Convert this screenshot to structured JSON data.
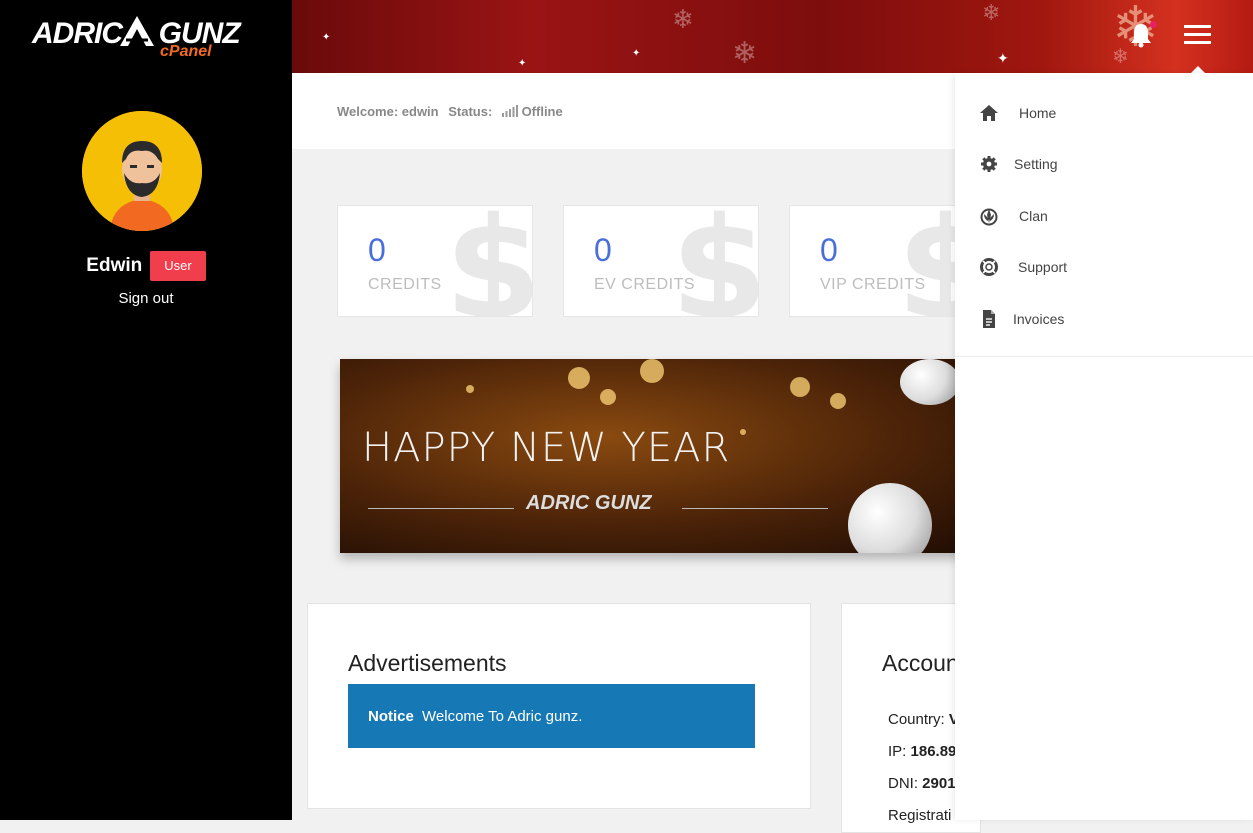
{
  "brand": {
    "logo_text": "ADRIC GUNZ",
    "logo_sub": "cPanel"
  },
  "user": {
    "name": "Edwin",
    "role_badge": "User",
    "sign_out": "Sign out"
  },
  "welcome": {
    "welcome_label": "Welcome: edwin",
    "status_label": "Status:",
    "status_value": "Offline"
  },
  "stats": [
    {
      "value": "0",
      "label": "CREDITS"
    },
    {
      "value": "0",
      "label": "EV CREDITS"
    },
    {
      "value": "0",
      "label": "VIP CREDITS"
    }
  ],
  "banner": {
    "title": "HAPPY NEW YEAR",
    "logo": "ADRIC GUNZ"
  },
  "ads": {
    "title": "Advertisements",
    "notice_label": "Notice",
    "notice_text": "Welcome To Adric gunz."
  },
  "account": {
    "title": "Accoun",
    "country_label": "Country:",
    "country_value": "V",
    "ip_label": "IP:",
    "ip_value": "186.89",
    "dni_label": "DNI:",
    "dni_value": "2901",
    "registration_label": "Registrati"
  },
  "menu": {
    "items": [
      {
        "label": "Home",
        "icon": "home-icon"
      },
      {
        "label": "Setting",
        "icon": "gear-icon"
      },
      {
        "label": "Clan",
        "icon": "clan-icon"
      },
      {
        "label": "Support",
        "icon": "lifebuoy-icon"
      },
      {
        "label": "Invoices",
        "icon": "document-icon"
      }
    ]
  },
  "colors": {
    "sidebar": "#000000",
    "badge": "#f03e4c",
    "notice": "#1678b4",
    "accent_number": "#4a6fdc"
  }
}
